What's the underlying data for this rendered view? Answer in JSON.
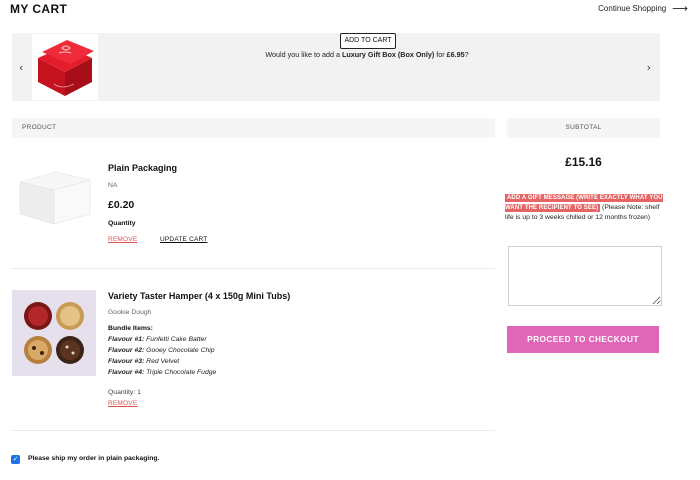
{
  "header": {
    "title": "MY CART",
    "continue_label": "Continue Shopping",
    "continue_arrow": "⟶"
  },
  "upsell": {
    "prev_glyph": "‹",
    "next_glyph": "›",
    "message_prefix": "Would you like to add a ",
    "message_product": "Luxury Gift Box (Box Only)",
    "message_middle": " for ",
    "message_price": "£6.95",
    "message_suffix": "?",
    "add_label": "ADD TO CART"
  },
  "table": {
    "product_header": "PRODUCT",
    "subtotal_header": "SUBTOTAL"
  },
  "items": [
    {
      "name": "Plain Packaging",
      "variant": "NA",
      "price": "£0.20",
      "quantity_label": "Quantity",
      "remove_label": "REMOVE",
      "update_label": "UPDATE CART"
    },
    {
      "name": "Variety Taster Hamper (4 x 150g Mini Tubs)",
      "variant": "Gookie Dough",
      "bundle_title": "Bundle Items:",
      "flavours": [
        {
          "label": "Flavour #1:",
          "value": "Funfetti Cake Batter"
        },
        {
          "label": "Flavour #2:",
          "value": "Gooey Chocolate Chip"
        },
        {
          "label": "Flavour #3:",
          "value": "Red Velvet"
        },
        {
          "label": "Flavour #4:",
          "value": "Triple Chocolate Fudge"
        }
      ],
      "quantity_text": "Quantity: 1",
      "remove_label": "REMOVE"
    }
  ],
  "summary": {
    "subtotal": "£15.16",
    "gift_highlight": "ADD A GIFT MESSAGE (WRITE EXACTLY WHAT YOU WANT THE RECIPIENT TO SEE)",
    "gift_note": " (Please Note: shelf life is up to 3 weeks chilled or 12 months frozen)",
    "checkout_label": "PROCEED TO CHECKOUT"
  },
  "plain_packaging": {
    "checked": true,
    "label": "Please ship my order in plain packaging."
  },
  "colors": {
    "checkout": "#e067b7",
    "remove": "#d9534f",
    "gift_highlight": "#e56464",
    "checkbox": "#1a73e8"
  }
}
